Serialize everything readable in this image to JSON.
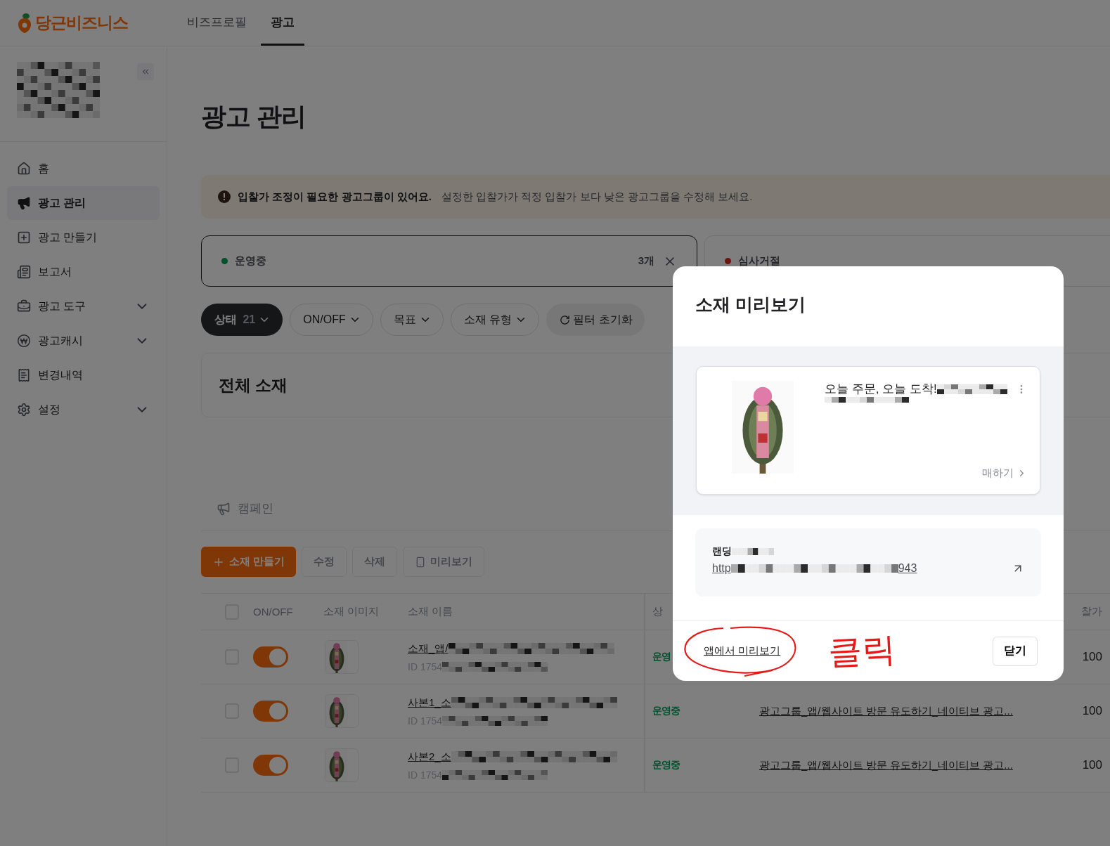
{
  "header": {
    "logo": "당근비즈니스",
    "tabs": [
      {
        "label": "비즈프로필",
        "selected": false
      },
      {
        "label": "광고",
        "selected": true
      }
    ]
  },
  "sidebar": {
    "items": [
      {
        "label": "홈",
        "selected": false
      },
      {
        "label": "광고 관리",
        "selected": true
      },
      {
        "label": "광고 만들기",
        "selected": false
      },
      {
        "label": "보고서",
        "selected": false
      },
      {
        "label": "광고 도구",
        "selected": false,
        "expanded": false
      },
      {
        "label": "광고캐시",
        "selected": false,
        "expanded": false
      },
      {
        "label": "변경내역",
        "selected": false
      },
      {
        "label": "설정",
        "selected": false,
        "expanded": false
      }
    ]
  },
  "page": {
    "title": "광고 관리",
    "alert": {
      "title": "입찰가 조정이 필요한 광고그룹이 있어요.",
      "text": "설정한 입찰가가 적정 입찰가 보다 낮은 광고그룹을 수정해 보세요."
    },
    "status_cards": [
      {
        "label": "운영중",
        "color": "#00502e",
        "count": "3개",
        "selected": true
      },
      {
        "label": "심사거절",
        "color": "#70130e",
        "selected": false
      }
    ],
    "filters": [
      {
        "label": "상태",
        "count": "21",
        "kind": "dropdown",
        "selected": true
      },
      {
        "label": "ON/OFF",
        "kind": "dropdown",
        "selected": false
      },
      {
        "label": "목표",
        "kind": "dropdown",
        "selected": false
      },
      {
        "label": "소재 유형",
        "kind": "dropdown",
        "selected": false
      },
      {
        "label": "필터 초기화",
        "kind": "reset",
        "selected": false
      }
    ],
    "section_title": "전체 소재",
    "tab": {
      "label": "캠페인"
    },
    "actions": [
      {
        "label": "소재 만들기",
        "kind": "primary",
        "disabled": false
      },
      {
        "label": "수정",
        "kind": "plain",
        "disabled": true
      },
      {
        "label": "삭제",
        "kind": "plain",
        "disabled": true
      },
      {
        "label": "미리보기",
        "kind": "preview",
        "disabled": true
      }
    ],
    "table": {
      "all_checked": false,
      "columns": [
        "ON/OFF",
        "소재 이미지",
        "소재 이름",
        "상",
        "찰가"
      ],
      "rows": [
        {
          "checked": false,
          "on": true,
          "name": "소재_앱/",
          "id": "ID 1754",
          "status": "운영",
          "bid": "100"
        },
        {
          "checked": false,
          "on": true,
          "name": "사본1_소",
          "id": "ID 1754",
          "status": "운영중",
          "group": "광고그룹_앱/웹사이트 방문 유도하기_네이티브 광고...",
          "bid": "100"
        },
        {
          "checked": false,
          "on": true,
          "name": "사본2_소",
          "id": "ID 1754",
          "status": "운영중",
          "group": "광고그룹_앱/웹사이트 방문 유도하기_네이티브 광고...",
          "bid": "100"
        }
      ]
    }
  },
  "modal": {
    "title": "소재 미리보기",
    "ad": {
      "headline": "오늘 주문, 오늘 도착!",
      "cta": "매하기"
    },
    "landing": {
      "label": "랜딩",
      "url_start": "http",
      "url_end": "943"
    },
    "link": "앱에서 미리보기",
    "close": "닫기",
    "annotation": "클릭"
  }
}
